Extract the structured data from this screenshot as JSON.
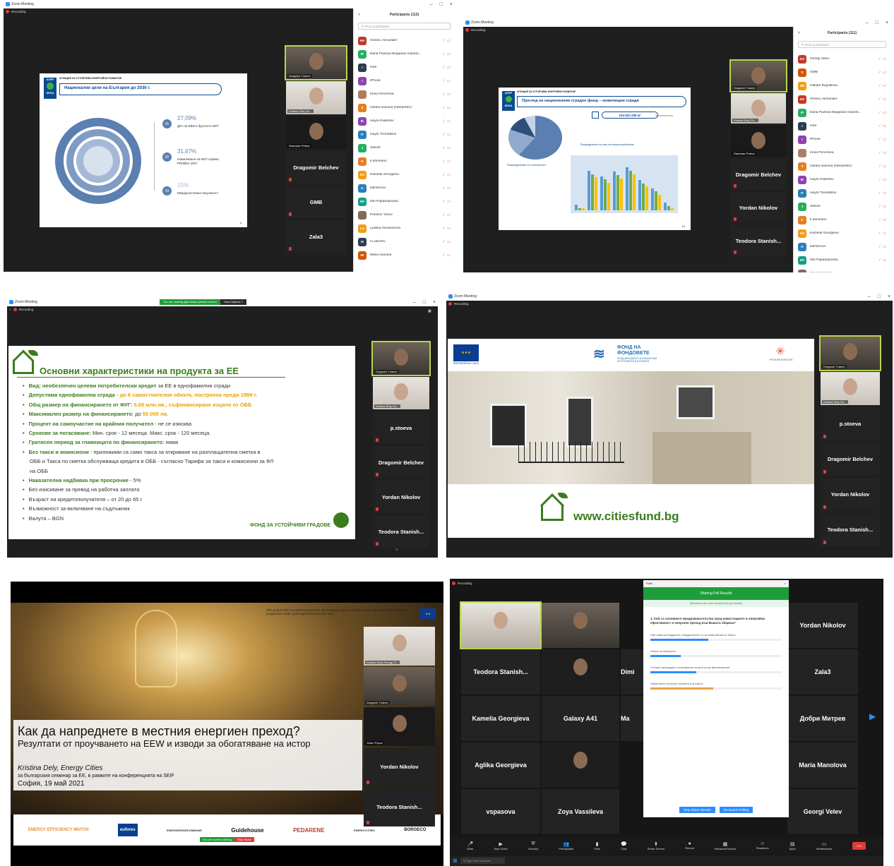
{
  "app": {
    "title": "Zoom Meeting",
    "recording": "Recording"
  },
  "s1": {
    "participants_title": "Participants (113)",
    "search_placeholder": "Find a participant",
    "slide": {
      "agency": "АГЕНЦИЯ ЗА УСТОЙЧИВО ЕНЕРГИЙНО РАЗВИТИЕ",
      "logo_top": "АУЕР",
      "logo_bottom": "SEDA",
      "title": "Национални цели на България до 2030 г.",
      "page_no": "4",
      "stats": [
        {
          "num": "01",
          "value": "27,09%",
          "label": "Дял на ЕВИ в брутното КЕП"
        },
        {
          "num": "02",
          "value": "31,67%",
          "label": "Намаляване на КЕП спрямо PRIMES 2007"
        },
        {
          "num": "03",
          "value": "15%",
          "label": "Междусистемна свързаност"
        }
      ]
    },
    "tiles": [
      {
        "name": "Dragomir Tzanev"
      },
      {
        "name": "Kristina Dely, En..."
      },
      {
        "name": "Radoslav Petkov"
      },
      {
        "name": "Dragomir Belchev"
      },
      {
        "name": "GMB"
      },
      {
        "name": "Zala3"
      }
    ],
    "participants": [
      {
        "initials": "HA",
        "name": "Hristov, Alexander",
        "color": "#c0392b"
      },
      {
        "initials": "IP",
        "name": "Iliana Pavlova Bulgarian Industri...",
        "color": "#27ae60"
      },
      {
        "initials": "I",
        "name": "Intel",
        "color": "#2c3e50"
      },
      {
        "initials": "I",
        "name": "iPhone",
        "color": "#8e44ad"
      },
      {
        "initials": "",
        "name": "Irena Pencheva",
        "color": "#b07d62"
      },
      {
        "initials": "II",
        "name": "Ivanka Ivanova (Interpreter)",
        "color": "#e67e22"
      },
      {
        "initials": "IK",
        "name": "Ivaylo Kadishev",
        "color": "#8e44ad"
      },
      {
        "initials": "IT",
        "name": "Ivaylo Trendafilov",
        "color": "#2980b9"
      },
      {
        "initials": "J",
        "name": "JelkoD",
        "color": "#27ae60"
      },
      {
        "initials": "K",
        "name": "k.ahmedov",
        "color": "#e67e22"
      },
      {
        "initials": "KG",
        "name": "Kamelia Georgieva",
        "color": "#f39c12"
      },
      {
        "initials": "K",
        "name": "kdimitrova",
        "color": "#2980b9"
      },
      {
        "initials": "KP",
        "name": "Kiki Papadopoulou",
        "color": "#16a085"
      },
      {
        "initials": "",
        "name": "Krasimir Yazov",
        "color": "#7f6a5a"
      },
      {
        "initials": "LA",
        "name": "Lyubka Alexandrova",
        "color": "#f39c12"
      },
      {
        "initials": "M",
        "name": "m.valchev",
        "color": "#2c3e50"
      },
      {
        "initials": "MI",
        "name": "Maria Ivanova",
        "color": "#d35400"
      }
    ]
  },
  "s2": {
    "participants_title": "Participants (111)",
    "search_placeholder": "Find a participant",
    "slide": {
      "agency": "АГЕНЦИЯ ЗА УСТОЙЧИВО ЕНЕРГИЙНО РАЗВИТИЕ",
      "logo_top": "АУЕР",
      "logo_bottom": "SEDA",
      "title": "Преглед на националния сграден фонд – нежилищни сгради",
      "area": "104 923 206 м²",
      "area_caption": "Застроена площ",
      "pie_caption": "Разпределение по собственост",
      "bars_caption": "Разпределение по клас на енергопотребление",
      "page_no": "10"
    },
    "tiles": [
      {
        "name": "Dragomir Tzanev"
      },
      {
        "name": "Kristina Dely, En..."
      },
      {
        "name": "Radoslav Petkov"
      },
      {
        "name": "Dragomir Belchev"
      },
      {
        "name": "Yordan Nikolov"
      },
      {
        "name": "Teodora Stanish..."
      }
    ],
    "participants": [
      {
        "initials": "GV",
        "name": "Georgi Velev",
        "color": "#c0392b"
      },
      {
        "initials": "G",
        "name": "GMB",
        "color": "#d35400"
      },
      {
        "initials": "HB",
        "name": "Habibe Bogutlieva",
        "color": "#f39c12"
      },
      {
        "initials": "HA",
        "name": "Hristov, Alexander",
        "color": "#c0392b"
      },
      {
        "initials": "IP",
        "name": "Iliana Pavlova Bulgarian Industri...",
        "color": "#27ae60"
      },
      {
        "initials": "I",
        "name": "Intel",
        "color": "#2c3e50"
      },
      {
        "initials": "I",
        "name": "iPhone",
        "color": "#8e44ad"
      },
      {
        "initials": "",
        "name": "Irena Pencheva",
        "color": "#b07d62"
      },
      {
        "initials": "II",
        "name": "Ivanka Ivanova (Interpreter)",
        "color": "#e67e22"
      },
      {
        "initials": "IK",
        "name": "Ivaylo Kadishev",
        "color": "#8e44ad"
      },
      {
        "initials": "IT",
        "name": "Ivaylo Trendafilov",
        "color": "#2980b9"
      },
      {
        "initials": "J",
        "name": "JelkoD",
        "color": "#27ae60"
      },
      {
        "initials": "K",
        "name": "k.ahmedov",
        "color": "#e67e22"
      },
      {
        "initials": "KG",
        "name": "Kamelia Georgieva",
        "color": "#f39c12"
      },
      {
        "initials": "K",
        "name": "kdimitrova",
        "color": "#2980b9"
      },
      {
        "initials": "KP",
        "name": "Kiki Papadopoulou",
        "color": "#16a085"
      },
      {
        "initials": "",
        "name": "Krasimir Yazov",
        "color": "#7f6a5a"
      }
    ]
  },
  "s3": {
    "viewing_banner": "You are viewing Драгомир Цанев's screen",
    "view_options": "View Options ˅",
    "slide": {
      "title": "Основни характеристики на продукта за ЕЕ",
      "footer": "ФОНД ЗА УСТОЙЧИВИ ГРАДОВЕ",
      "bullets": [
        {
          "label": "Вид:  необезпечен целеви потребителски кредит",
          "text": " за ЕЕ в еднофамилни сгради"
        },
        {
          "label": "Допустима еднофамилна сграда",
          "text": " - ",
          "orange": "до 6 самостоятелни обекта, построена преди 1999 г."
        },
        {
          "label": "Общ размер на финансирането от ФУГ:",
          "text": " ",
          "orange": "5.05 млн.лв., съфинансиране изцяло от ОББ"
        },
        {
          "label": "Максимален  размер на финансирането",
          "text": ": до ",
          "orange": "55 000 лв."
        },
        {
          "label": "Процент на самоучастие на крайния получател",
          "text": " - не се изисква"
        },
        {
          "label": "Срокове за погасяване:",
          "text": " Мин. срок - 12 месеца. Макс. срок - 120 месеца."
        },
        {
          "label": "Гратисен период за главницата по финансирането:",
          "text": " няма"
        },
        {
          "label": "Без такси и комисиони",
          "text": " - приложими са само такса за откриване на разплащателна сметка в"
        },
        {
          "label": "",
          "text": "ОББ и Такса по сметка обслужваща кредита в ОББ - съгласно Тарифа за такси и комисиони за ФЛ",
          "nobullet": true
        },
        {
          "label": "",
          "text": "на ОББ",
          "nobullet": true
        },
        {
          "label": "Наказателна надбавка при просрочие",
          "text": " - 5%"
        },
        {
          "label": "",
          "text": "Без изискване за превод на работна заплата"
        },
        {
          "label": "",
          "text": "Възраст на кредитополучателя – от 20 до 65 г"
        },
        {
          "label": "",
          "text": "Възможност за включване на съдлъжник"
        },
        {
          "label": "",
          "text": "Валута – BGN"
        }
      ]
    },
    "tiles": [
      {
        "name": "Dragomir Tzanev"
      },
      {
        "name": "Kristina Dely, En..."
      },
      {
        "name": "p.stoeva"
      },
      {
        "name": "Dragomir Belchev"
      },
      {
        "name": "Yordan Nikolov"
      },
      {
        "name": "Teodora Stanish..."
      }
    ]
  },
  "s4": {
    "eu_caption": "ЕВРОПЕЙСКИ СЪЮЗ",
    "fund_title_1": "ФОНД НА",
    "fund_title_2": "ФОНДОВЕТЕ",
    "fund_sub": "ФОНД МЕНИДЖЪР НА ФИНАНСОВИ ИНСТРУМЕНТИ В БЪЛГАРИЯ",
    "region_caption": "РЕГИОНИ В РАСТЕЖ",
    "url": "www.citiesfund.bg",
    "tiles": [
      {
        "name": "Dragomir Tzanev"
      },
      {
        "name": "Kristina Dely, En..."
      },
      {
        "name": "p.stoeva"
      },
      {
        "name": "Dragomir Belchev"
      },
      {
        "name": "Yordan Nikolov"
      },
      {
        "name": "Teodora Stanish..."
      }
    ]
  },
  "s5": {
    "funding_note": "This project has received funding from the European Union's Horizon 2020 research and innovation programme under grant agreement No 847 153",
    "title": "Как да напреднете в местния енергиен преход?",
    "subtitle": "Резултати от проучването на EEW и изводи за обогатяване на истор",
    "author": "Kristina Dely, Energy Cities",
    "event": "за българския семинар за ЕЕ, в рамките на конференцията на SEIF",
    "place_date": "София, 19 май 2021",
    "logos": [
      "ENERGY EFFICIENCY WATCH",
      "eufores",
      "ENERGIESPARKOMMUNE",
      "Guidehouse",
      "PEDARENE",
      "ENERGYCITIES",
      "BORGECO"
    ],
    "sharing_text": "You are screen sharing",
    "stop_share": "Stop Share",
    "tiles": [
      {
        "name": "Kristina Dely, Energy Ci..."
      },
      {
        "name": "Dragomir Tzanev"
      },
      {
        "name": "Julian Popov"
      },
      {
        "name": "Yordan Nikolov"
      },
      {
        "name": "Teodora Stanish..."
      }
    ]
  },
  "s6": {
    "poll_header": "Polls",
    "poll_title": "Sharing Poll Results",
    "poll_note": "Attendees are now viewing the poll results",
    "question": "1. Кой са основните предизвикателства пред инвестициите в енергийна ефективност и енергиен преход във Вашата община?",
    "options": [
      {
        "text": "Пан няма на бюджета/ с бюджетните/ тъ за енергийната в Тимсо",
        "pct": 0.44
      },
      {
        "text": "Липса на капацитет",
        "pct": 0.23
      },
      {
        "text": "Сложни процедури и изисквания за достъп до финансиране",
        "pct": 0.35
      },
      {
        "text": "Няма много интерес/ проекти в процеса",
        "pct": 0.48
      }
    ],
    "btn_stop": "Stop Share Results",
    "btn_rerun": "Re-launch Polling",
    "tiles": [
      {
        "name": "Yordan Nikolov"
      },
      {
        "name": "Teodora Stanish..."
      },
      {
        "name": "Zala3"
      },
      {
        "name": "Kamelia Georgieva"
      },
      {
        "name": "Galaxy A41"
      },
      {
        "name": "Добри Митрев"
      },
      {
        "name": "Aglika Georgieva"
      },
      {
        "name": "Maria Manolova"
      },
      {
        "name": "vspasova"
      },
      {
        "name": "Zoya Vassileva"
      },
      {
        "name": "Georgi Velev"
      },
      {
        "name": "Dimi"
      },
      {
        "name": "Ma"
      }
    ],
    "toolbar": [
      "Mute",
      "Stop Video",
      "Security",
      "Participants",
      "Polls",
      "Chat",
      "Share Screen",
      "Record",
      "Breakout Rooms",
      "Reactions",
      "Apps",
      "Whiteboards",
      "End"
    ],
    "search_placeholder": "Type here to search"
  }
}
